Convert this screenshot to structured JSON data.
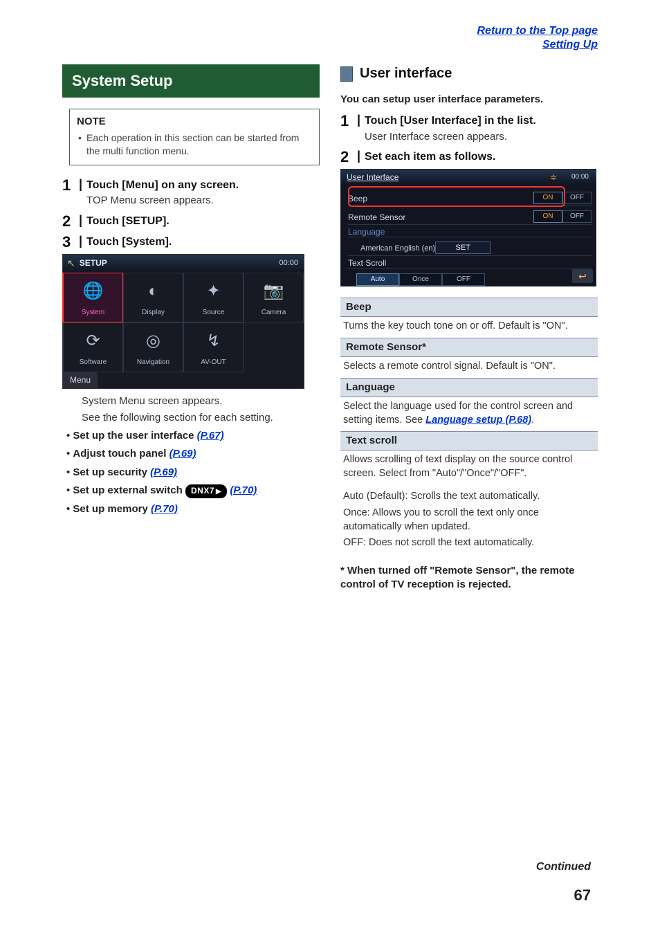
{
  "header": {
    "top_link_1": "Return to the Top page",
    "top_link_2": "Setting Up"
  },
  "left": {
    "section_title": "System Setup",
    "note_title": "NOTE",
    "note_body": "Each operation in this section can be started from the multi function menu.",
    "steps": [
      {
        "num": "1",
        "head": "Touch [Menu] on any screen.",
        "desc": "TOP Menu screen appears."
      },
      {
        "num": "2",
        "head": "Touch [SETUP]."
      },
      {
        "num": "3",
        "head": "Touch [System]."
      }
    ],
    "setup_shot": {
      "title": "SETUP",
      "clock": "00:00",
      "row1": [
        "System",
        "Display",
        "Source",
        "Camera"
      ],
      "row2": [
        "Software",
        "Navigation",
        "AV-OUT"
      ],
      "menu_label": "Menu"
    },
    "after_shot_1": "System Menu screen appears.",
    "after_shot_2": "See the following section for each setting.",
    "bullets": [
      {
        "text": "Set up the user interface",
        "ref": "(P.67)"
      },
      {
        "text": "Adjust touch panel",
        "ref": "(P.69)"
      },
      {
        "text": "Set up security",
        "ref": "(P.69)"
      },
      {
        "text": "Set up external switch",
        "badge": "DNX7",
        "ref": "(P.70)"
      },
      {
        "text": "Set up memory",
        "ref": "(P.70)"
      }
    ]
  },
  "right": {
    "title": "User interface",
    "intro": "You can setup user interface parameters.",
    "steps": [
      {
        "num": "1",
        "head": "Touch [User Interface] in the list.",
        "desc": "User Interface screen appears."
      },
      {
        "num": "2",
        "head": "Set each item as follows."
      }
    ],
    "ui_shot": {
      "title": "User Interface",
      "clock": "00:00",
      "rows": {
        "beep_label": "Beep",
        "toggle_on": "ON",
        "toggle_off": "OFF",
        "remote_label": "Remote Sensor",
        "language_label": "Language",
        "language_value": "American English (en)",
        "set_label": "SET",
        "textscroll_label": "Text Scroll",
        "scroll_auto": "Auto",
        "scroll_once": "Once",
        "scroll_off": "OFF"
      }
    },
    "defs": [
      {
        "head": "Beep",
        "body": "Turns the key touch tone on or off. Default is \"ON\"."
      },
      {
        "head": "Remote Sensor*",
        "body": "Selects a remote control signal. Default is \"ON\"."
      },
      {
        "head": "Language",
        "body_pre": "Select the language used for the control screen and setting items. See ",
        "ref": "Language setup (P.68)",
        "body_post": "."
      },
      {
        "head": "Text scroll",
        "body": "Allows scrolling of text display on the source control screen. Select from \"Auto\"/\"Once\"/\"OFF\"."
      }
    ],
    "textscroll_opts": [
      {
        "lbl": "Auto (Default)",
        "desc": ": Scrolls the text automatically."
      },
      {
        "lbl": "Once",
        "desc": ": Allows you to scroll the text only once automatically when updated."
      },
      {
        "lbl": "OFF",
        "desc": ": Does not scroll the text automatically."
      }
    ],
    "footnote": "* When turned off \"Remote Sensor\", the remote control of TV reception is rejected."
  },
  "footer": {
    "continued": "Continued",
    "page_num": "67"
  }
}
